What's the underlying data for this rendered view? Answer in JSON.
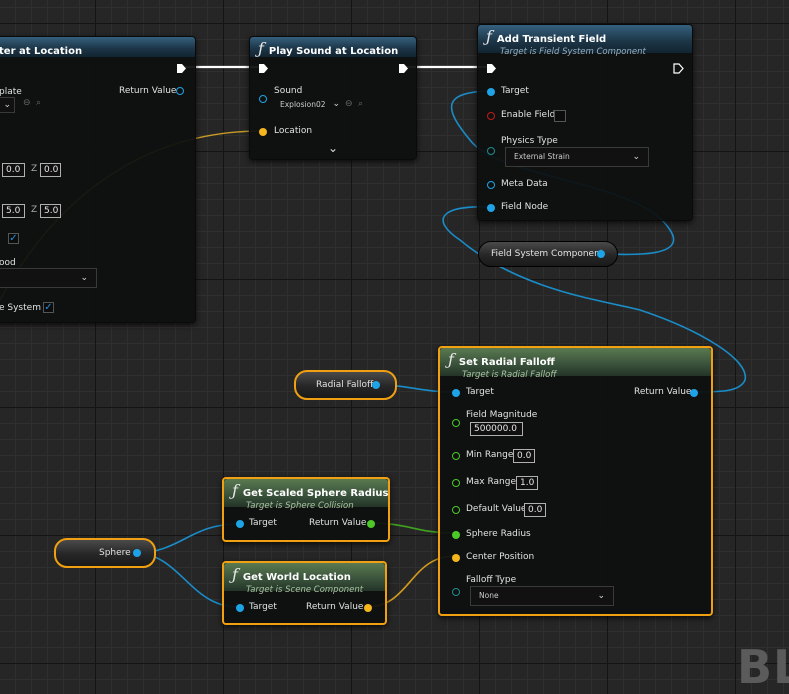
{
  "watermark": "BL",
  "spawn_node": {
    "title": "ter at Location",
    "return_value": "Return Value",
    "template_label": "plate",
    "loc_x": "0.0",
    "loc_z": "0.0",
    "scale_x": "5.0",
    "scale_z": "5.0",
    "z_label": "Z",
    "method_label": "ood",
    "system_label": "e System"
  },
  "play_sound": {
    "title": "Play Sound at Location",
    "sound_label": "Sound",
    "sound_value": "Explosion02",
    "location_label": "Location",
    "expand": "⌄"
  },
  "add_transient": {
    "title": "Add Transient Field",
    "subtitle": "Target is Field System Component",
    "target": "Target",
    "enable_field": "Enable Field",
    "physics_type": "Physics Type",
    "physics_value": "External Strain",
    "meta_data": "Meta Data",
    "field_node": "Field Node"
  },
  "field_system_component": {
    "label": "Field System Component"
  },
  "radial_falloff_var": {
    "label": "Radial Falloff"
  },
  "set_radial_falloff": {
    "title": "Set Radial Falloff",
    "subtitle": "Target is Radial Falloff",
    "target": "Target",
    "return_value": "Return Value",
    "field_magnitude": "Field Magnitude",
    "field_magnitude_value": "500000.0",
    "min_range": "Min Range",
    "min_range_value": "0.0",
    "max_range": "Max Range",
    "max_range_value": "1.0",
    "default_value": "Default Value",
    "default_value_value": "0.0",
    "sphere_radius": "Sphere Radius",
    "center_position": "Center Position",
    "falloff_type": "Falloff Type",
    "falloff_value": "None"
  },
  "get_scaled_sphere_radius": {
    "title": "Get Scaled Sphere Radius",
    "subtitle": "Target is Sphere Collision",
    "target": "Target",
    "return_value": "Return Value"
  },
  "get_world_location": {
    "title": "Get World Location",
    "subtitle": "Target is Scene Component",
    "target": "Target",
    "return_value": "Return Value"
  },
  "sphere_var": {
    "label": "Sphere"
  },
  "colors": {
    "object_pin": "#1ea3e6",
    "vector_pin": "#f5b51c",
    "float_pin": "#4cc928",
    "selection": "#f0a010"
  }
}
